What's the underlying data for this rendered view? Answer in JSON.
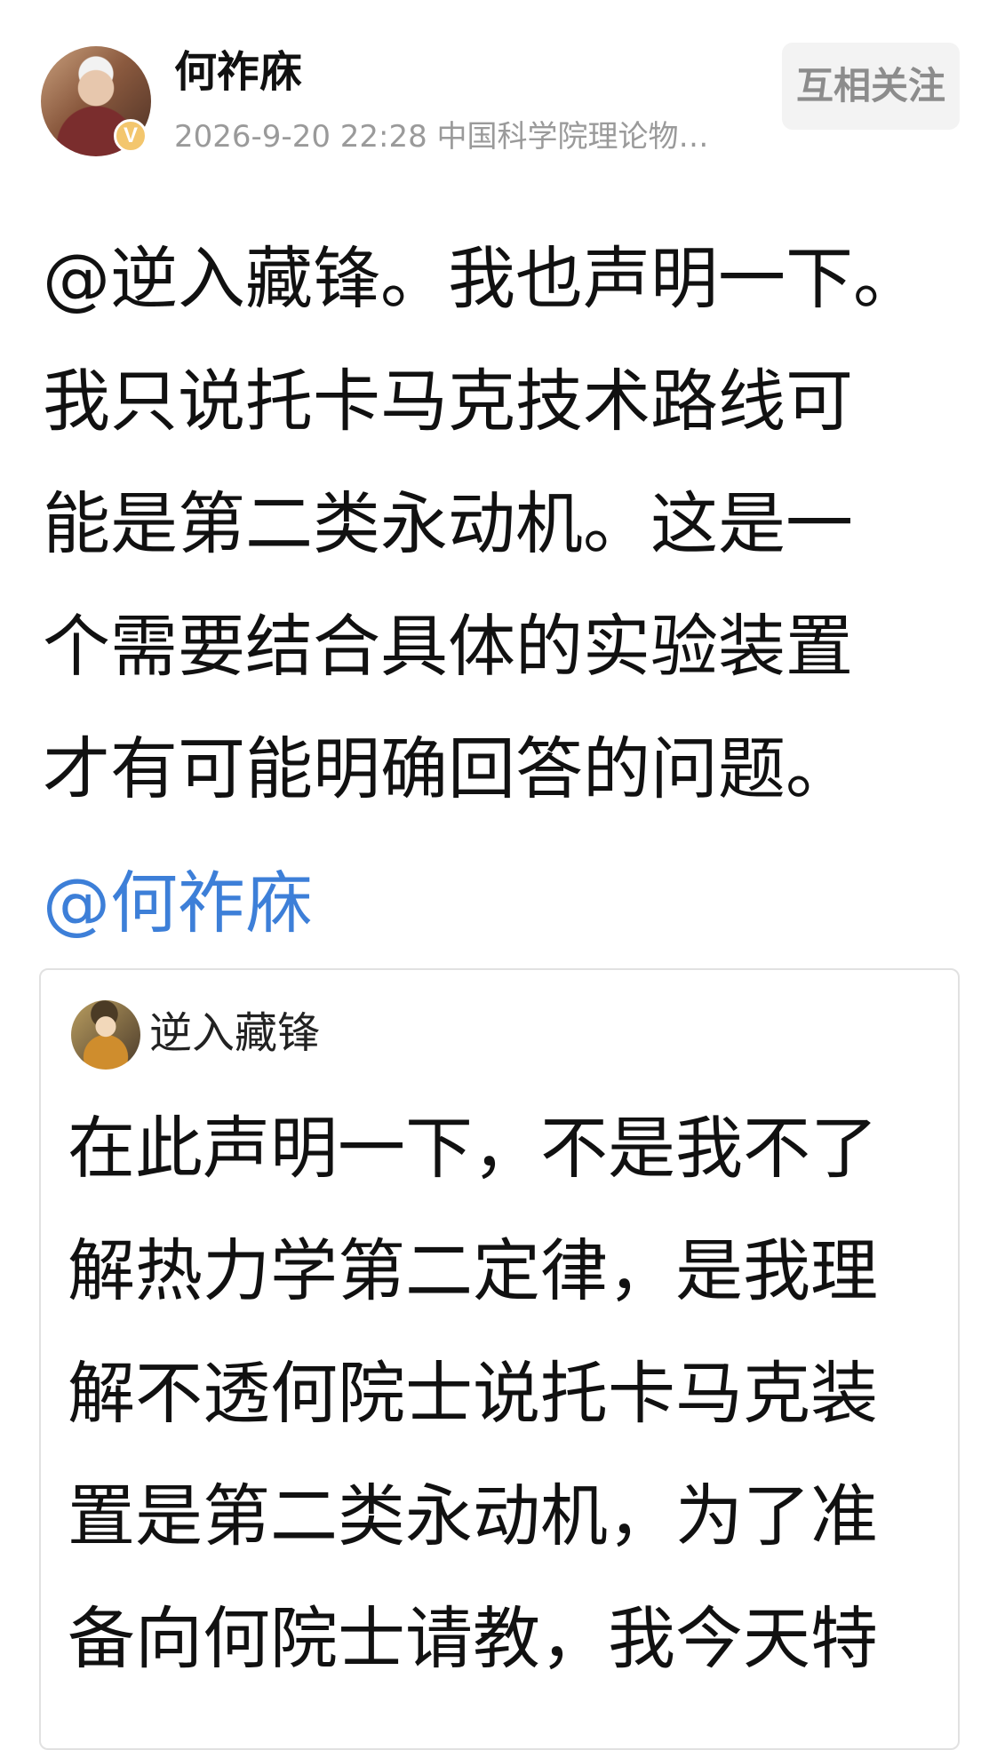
{
  "author": {
    "name": "何祚庥",
    "meta": "2026-9-20 22:28 中国科学院理论物…",
    "verified_badge": "V",
    "follow_label": "互相关注",
    "colors": {
      "follow_bg": "#f3f3f3",
      "follow_text": "#8c8c8c",
      "verified_badge": "#f3c66d"
    }
  },
  "post": {
    "text": "@逆入藏锋。我也声明一下。\n我只说托卡马克技术路线可\n能是第二类永动机。这是一\n个需要结合具体的实验装置\n才有可能明确回答的问题。",
    "mention": "@何祚庥",
    "mention_color": "#3d7fd8"
  },
  "quoted": {
    "name": "逆入藏锋",
    "text": "在此声明一下，不是我不了\n解热力学第二定律，是我理\n解不透何院士说托卡马克装\n置是第二类永动机，为了准\n备向何院士请教，我今天特"
  }
}
